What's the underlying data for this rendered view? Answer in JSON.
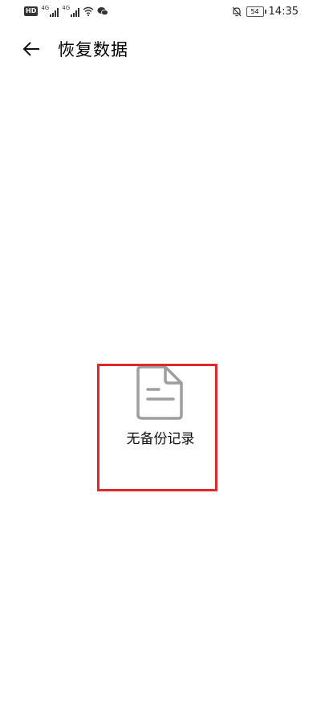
{
  "status_bar": {
    "left_badge": "HD",
    "network_tag_1": "4G",
    "network_tag_2": "4G",
    "battery_level": "54",
    "time": "14:35"
  },
  "app_bar": {
    "title": "恢复数据"
  },
  "empty_state": {
    "message": "无备份记录"
  },
  "icons": {
    "back": "arrow-left-icon",
    "document": "document-icon",
    "wifi": "wifi-icon",
    "wechat": "wechat-icon",
    "mute": "bell-off-icon"
  },
  "colors": {
    "background": "#ffffff",
    "icon_gray": "#9e9e9e",
    "highlight": "#e0262f"
  }
}
